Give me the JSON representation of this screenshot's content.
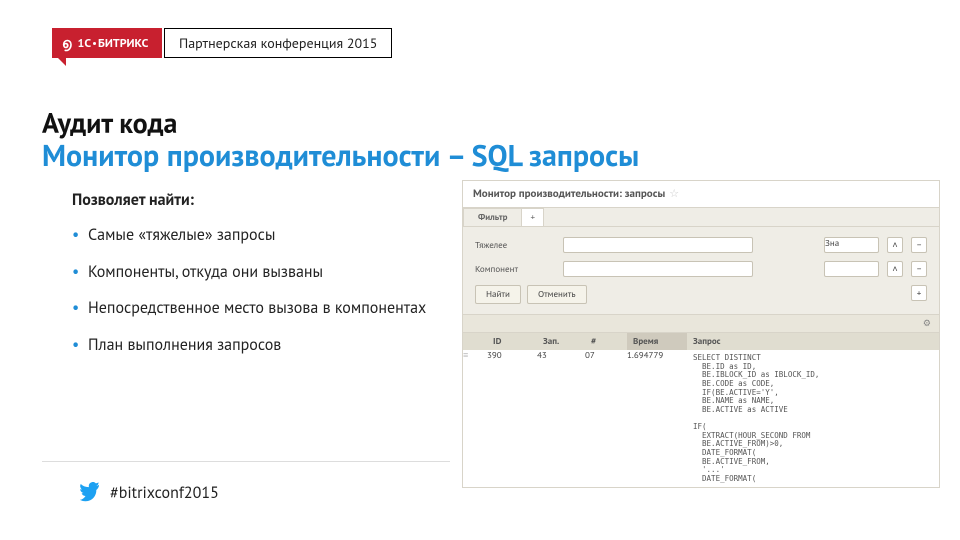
{
  "header": {
    "brand": "1С·БИТРИКС",
    "conference": "Партнерская конференция 2015"
  },
  "titles": {
    "line1": "Аудит кода",
    "line2": "Монитор производительности – SQL запросы"
  },
  "bullets": {
    "lead": "Позволяет найти:",
    "items": [
      "Самые «тяжелые» запросы",
      "Компоненты, откуда они вызваны",
      "Непосредственное место вызова в компонентах",
      "План выполнения запросов"
    ]
  },
  "footer": {
    "hashtag": "#bitrixconf2015"
  },
  "screenshot": {
    "title": "Монитор производительности: запросы",
    "tab_filter": "Фильтр",
    "tab_plus": "+",
    "filter_label1": "Тяжелее",
    "filter_label2": "Компонент",
    "filter_condition": "Зна",
    "btn_find": "Найти",
    "btn_cancel": "Отменить",
    "columns": {
      "c1": "ID",
      "c2": "Зап.",
      "c3": "#",
      "c4": "Время",
      "c5": "Запрос"
    },
    "row": {
      "id": "390",
      "hits": "43",
      "num": "07",
      "time": "1.694779",
      "sql": "SELECT DISTINCT\n  BE.ID as ID,\n  BE.IBLOCK_ID as IBLOCK_ID,\n  BE.CODE as CODE,\n  IF(BE.ACTIVE='Y',\n  BE.NAME as NAME,\n  BE.ACTIVE as ACTIVE\n\nIF(\n  EXTRACT(HOUR_SECOND FROM\n  BE.ACTIVE_FROM)>0,\n  DATE_FORMAT(\n  BE.ACTIVE_FROM,\n  '...'\n  DATE_FORMAT("
    }
  }
}
